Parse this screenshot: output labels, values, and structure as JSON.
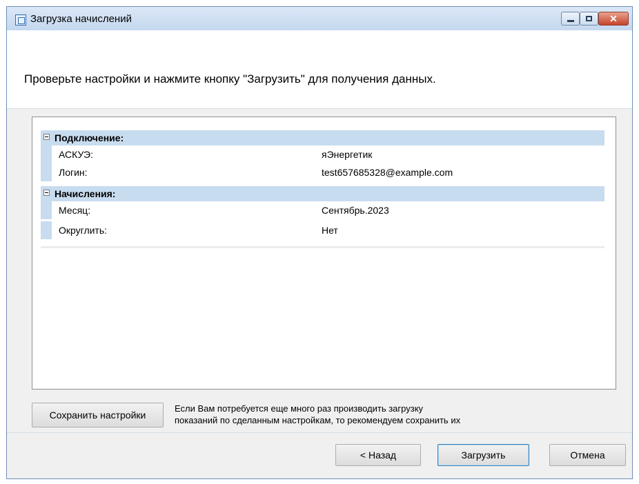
{
  "window": {
    "title": "Загрузка начислений"
  },
  "header": {
    "instruction": "Проверьте настройки и нажмите кнопку \"Загрузить\" для получения данных."
  },
  "grid": {
    "categories": [
      {
        "label": "Подключение:",
        "rows": [
          {
            "name": "АСКУЭ:",
            "value": "яЭнергетик"
          },
          {
            "name": "Логин:",
            "value": "test657685328@example.com"
          }
        ]
      },
      {
        "label": "Начисления:",
        "rows": [
          {
            "name": "Месяц:",
            "value": "Сентябрь.2023"
          },
          {
            "name": "Округлить:",
            "value": "Нет"
          }
        ]
      }
    ]
  },
  "save": {
    "label": "Сохранить настройки",
    "hint_line1": "Если Вам потребуется еще много раз производить загрузку",
    "hint_line2": "показаний по сделанным настройкам, то рекомендуем сохранить их"
  },
  "footer": {
    "back_label": "< Назад",
    "load_label": "Загрузить",
    "cancel_label": "Отмена"
  },
  "icons": {
    "app": "app-window-icon",
    "minimize": "minimize-icon",
    "maximize": "maximize-icon",
    "close": "close-icon",
    "collapse": "collapse-minus-icon"
  },
  "colors": {
    "category_background": "#c8dcf0",
    "title_bar": "#c5d8ef",
    "close_button": "#c7442b"
  }
}
